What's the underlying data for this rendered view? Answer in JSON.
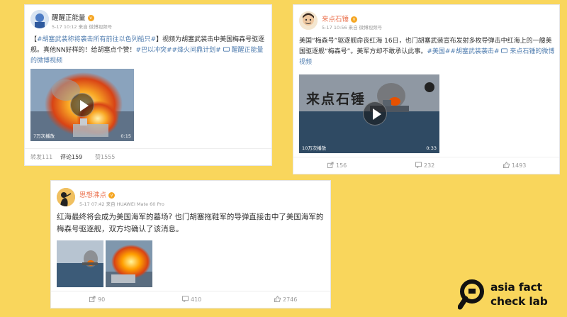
{
  "posts": [
    {
      "username": "醒醒正能量",
      "meta": "5-17 10:12 来自 微博视频号",
      "text_plain_1": "【",
      "text_link_1": "#胡塞武装称将袭击所有前往以色列船只#",
      "text_plain_2": "】视频为胡塞武装击中美国梅森号驱逐舰。真他NN好样的！给胡塞点个赞！",
      "text_link_2": "#巴以冲突##烽火间鼎计划#",
      "text_link_3": "醒醒正能量的微博视频",
      "video": {
        "views": "7万次播放",
        "duration": "0:15"
      },
      "actions": {
        "repost": "转发111",
        "comment": "评论159",
        "like": "赞1555"
      }
    },
    {
      "username": "来点石锤",
      "meta": "5-17 10:56 来自 微博视频号",
      "text_plain_1": "美国“梅森号”驱逐舰命丧红海 16日，也门胡塞武装宣布发射多枚导弹击中红海上的一艘美国驱逐舰“梅森号”。美军方却不敢承认此事。",
      "text_link_1": "#美国##胡塞武装袭击#",
      "text_link_2": "来点石锤的微博视频",
      "video": {
        "watermark": "来点石锤",
        "views": "10万次播放",
        "duration": "0:33"
      },
      "actions": {
        "repost": "156",
        "comment": "232",
        "like": "1493"
      }
    },
    {
      "username": "思想沸点",
      "meta": "5-17 07:42 来自 HUAWEI Mate 60 Pro",
      "text": "红海最终将会成为美国海军的墓场? 也门胡塞拖鞋军的导弹直接击中了美国海军的梅森号驱逐舰，双方均确认了该消息。",
      "actions": {
        "repost": "90",
        "comment": "410",
        "like": "2746"
      }
    }
  ],
  "logo": {
    "line1": "asia fact",
    "line2": "check lab"
  }
}
